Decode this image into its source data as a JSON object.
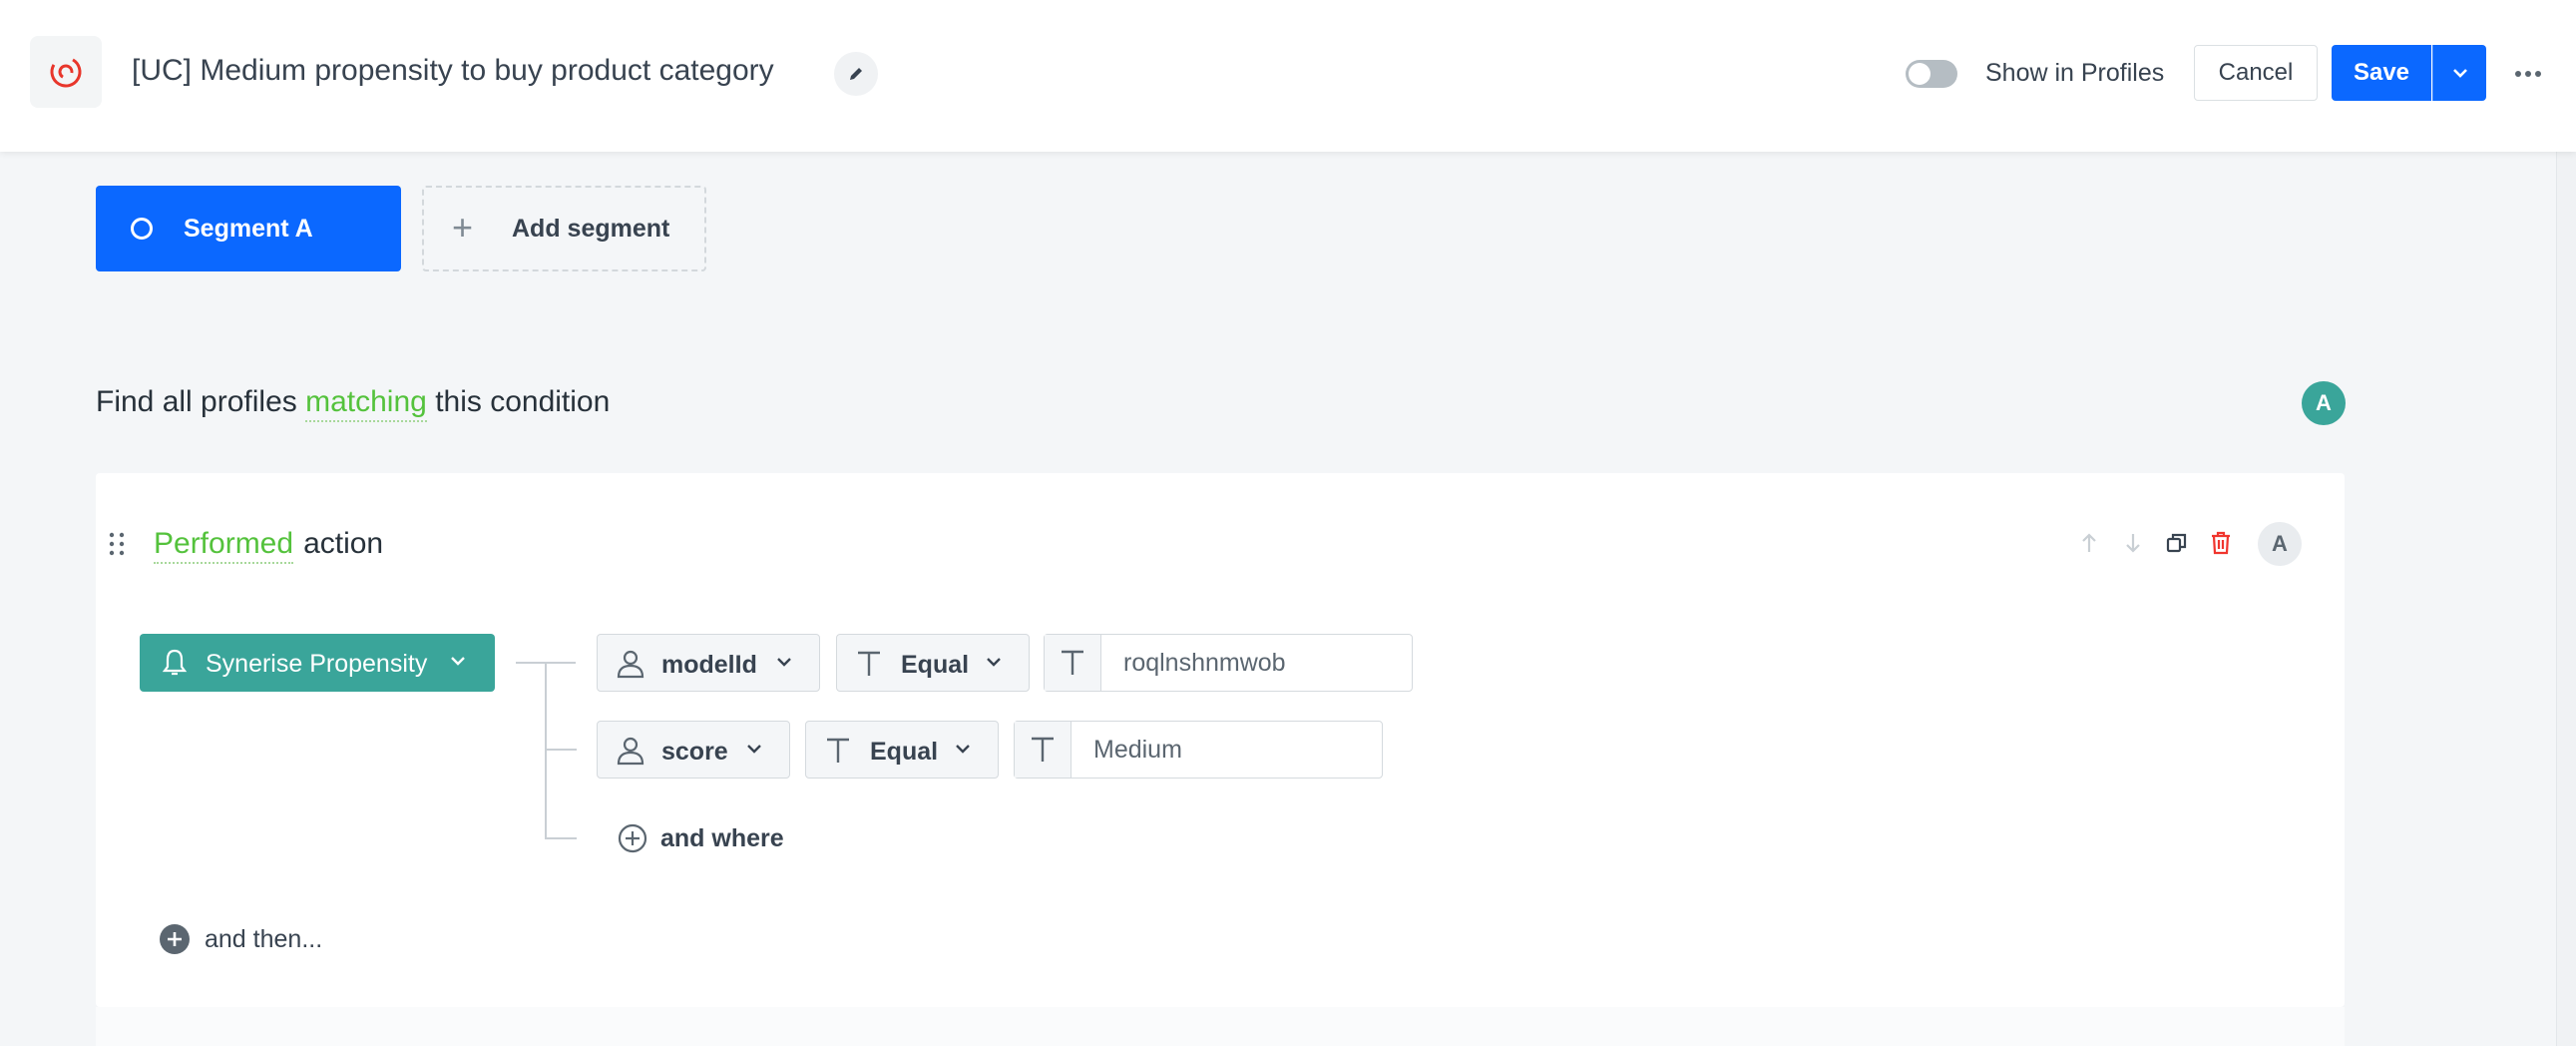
{
  "header": {
    "title": "[UC] Medium propensity to buy product category",
    "show_in_profiles_label": "Show in Profiles",
    "cancel_label": "Cancel",
    "save_label": "Save"
  },
  "segments": {
    "active_label": "Segment A",
    "add_label": "Add segment"
  },
  "condition": {
    "prefix": "Find all profiles",
    "keyword": "matching",
    "suffix": "this condition",
    "avatar": "A"
  },
  "step": {
    "keyword": "Performed",
    "suffix": "action",
    "avatar": "A",
    "event": "Synerise Propensity",
    "filters": [
      {
        "param": "modelId",
        "operator": "Equal",
        "value": "roqlnshnmwob"
      },
      {
        "param": "score",
        "operator": "Equal",
        "value": "Medium"
      }
    ],
    "and_where_label": "and where",
    "and_then_label": "and then..."
  },
  "colors": {
    "primary": "#0b68ff",
    "teal": "#3aa59a",
    "green_keyword": "#54c23c",
    "danger": "#f0352e"
  }
}
